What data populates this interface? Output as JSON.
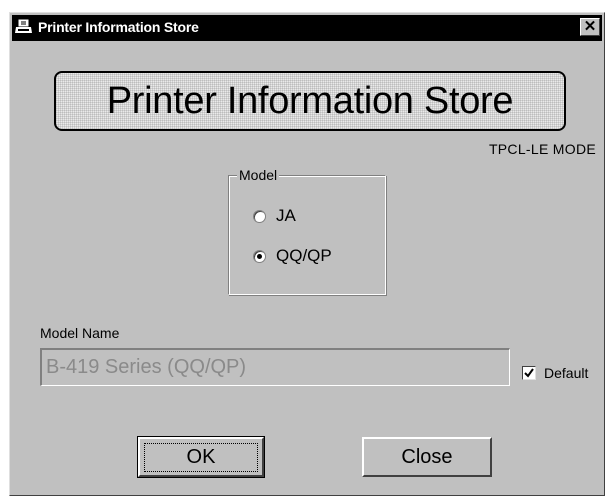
{
  "window": {
    "title": "Printer Information Store",
    "close_glyph": "✕",
    "icon": "printer-icon"
  },
  "banner": {
    "text": "Printer Information Store"
  },
  "mode": "TPCL-LE MODE",
  "model_group": {
    "legend": "Model",
    "options": [
      {
        "label": "JA",
        "checked": false
      },
      {
        "label": "QQ/QP",
        "checked": true
      }
    ]
  },
  "model_name": {
    "label": "Model Name",
    "value": "B-419 Series (QQ/QP)",
    "enabled": false
  },
  "default_checkbox": {
    "label": "Default",
    "checked": true
  },
  "buttons": {
    "ok_label": "OK",
    "close_label": "Close"
  },
  "colors": {
    "face": "#c0c0c0",
    "titlebar": "#000000",
    "disabled_text": "#8a8a8a"
  }
}
